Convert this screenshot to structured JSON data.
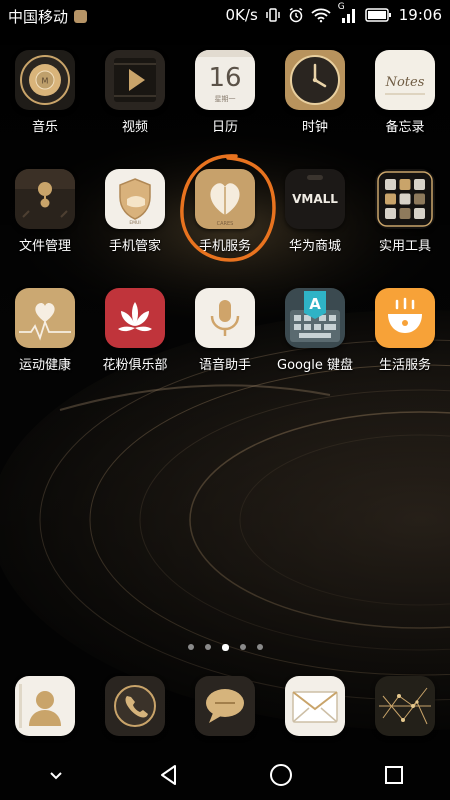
{
  "status_bar": {
    "carrier": "中国移动",
    "net_speed": "0K/s",
    "network_type": "G",
    "time": "19:06",
    "icons": [
      "vibrate-icon",
      "alarm-icon",
      "wifi-icon",
      "signal-icon",
      "battery-icon"
    ]
  },
  "apps": [
    [
      {
        "label": "音乐",
        "icon": "music-icon"
      },
      {
        "label": "视频",
        "icon": "video-icon"
      },
      {
        "label": "日历",
        "icon": "calendar-icon",
        "day": "16",
        "weekday": "星期一"
      },
      {
        "label": "时钟",
        "icon": "clock-icon"
      },
      {
        "label": "备忘录",
        "icon": "notes-icon",
        "icon_text": "Notes"
      }
    ],
    [
      {
        "label": "文件管理",
        "icon": "file-manager-icon"
      },
      {
        "label": "手机管家",
        "icon": "phone-manager-icon",
        "icon_text": "EMUI"
      },
      {
        "label": "手机服务",
        "icon": "phone-service-icon",
        "icon_text": "CARES"
      },
      {
        "label": "华为商城",
        "icon": "vmall-icon",
        "icon_text": "VMALL",
        ".com": ".COM"
      },
      {
        "label": "实用工具",
        "icon": "tools-icon"
      }
    ],
    [
      {
        "label": "运动健康",
        "icon": "health-icon"
      },
      {
        "label": "花粉俱乐部",
        "icon": "fans-club-icon"
      },
      {
        "label": "语音助手",
        "icon": "voice-assistant-icon"
      },
      {
        "label": "Google 键盘",
        "icon": "google-keyboard-icon",
        "icon_text": "A"
      },
      {
        "label": "生活服务",
        "icon": "life-service-icon"
      }
    ]
  ],
  "pager": {
    "count": 5,
    "active": 3
  },
  "dock": [
    {
      "icon": "contacts-icon"
    },
    {
      "icon": "phone-icon"
    },
    {
      "icon": "messages-icon"
    },
    {
      "icon": "email-icon"
    },
    {
      "icon": "browser-icon"
    }
  ],
  "navigation": [
    "collapse-icon",
    "back-icon",
    "home-icon",
    "recents-icon"
  ],
  "colors": {
    "gold": "#c9a46a",
    "dark": "#1c1a17",
    "annotation": "#e8731f"
  }
}
